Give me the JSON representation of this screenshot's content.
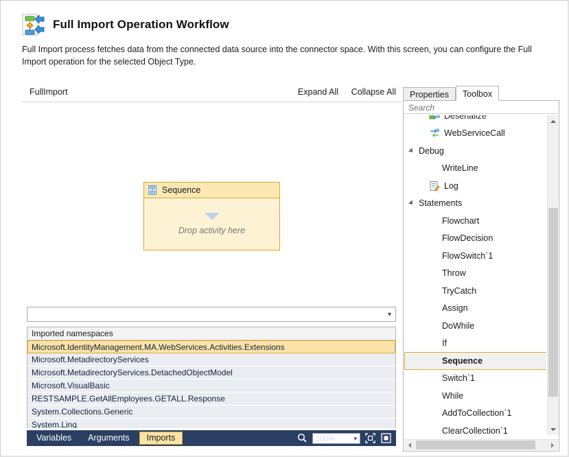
{
  "header": {
    "title": "Full Import Operation Workflow",
    "icon": "workflow-import-icon",
    "description": "Full Import process fetches data from the connected data source into the connector space. With this screen, you can configure the Full Import operation for the selected Object Type."
  },
  "designer": {
    "breadcrumb": "FullImport",
    "expand_all": "Expand All",
    "collapse_all": "Collapse All",
    "activity": {
      "icon": "sequence-activity-icon",
      "title": "Sequence",
      "drop_hint": "Drop activity here"
    },
    "namespace_combo": {
      "value": "",
      "placeholder": ""
    },
    "imports_grid": {
      "column_header": "Imported namespaces",
      "rows": [
        {
          "name": "Microsoft.IdentityManagement.MA.WebServices.Activities.Extensions",
          "selected": true
        },
        {
          "name": "Microsoft.MetadirectoryServices",
          "selected": false
        },
        {
          "name": "Microsoft.MetadirectoryServices.DetachedObjectModel",
          "selected": false
        },
        {
          "name": "Microsoft.VisualBasic",
          "selected": false
        },
        {
          "name": "RESTSAMPLE.GetAllEmployees.GETALL.Response",
          "selected": false
        },
        {
          "name": "System.Collections.Generic",
          "selected": false
        },
        {
          "name": "System.Linq",
          "selected": false
        }
      ]
    },
    "bottom_bar": {
      "tabs": [
        {
          "label": "Variables",
          "active": false
        },
        {
          "label": "Arguments",
          "active": false
        },
        {
          "label": "Imports",
          "active": true
        }
      ],
      "search_icon": "magnifier-icon",
      "zoom_value": "100%",
      "fit_to_screen_icon": "fit-to-screen-icon",
      "overview_map_icon": "overview-map-icon"
    }
  },
  "right_panel": {
    "tabs": [
      {
        "label": "Properties",
        "active": false
      },
      {
        "label": "Toolbox",
        "active": true
      }
    ],
    "search": {
      "placeholder": "Search",
      "value": ""
    },
    "tree": [
      {
        "label": "Deserialize",
        "type": "leaf",
        "icon": "deserialize-icon",
        "clipped": true,
        "selected": false
      },
      {
        "label": "WebServiceCall",
        "type": "leaf",
        "icon": "webservicecall-icon",
        "clipped": false,
        "selected": false
      },
      {
        "label": "Debug",
        "type": "group",
        "icon": "expander-icon",
        "clipped": false,
        "selected": false
      },
      {
        "label": "WriteLine",
        "type": "leaf",
        "icon": "",
        "clipped": false,
        "selected": false
      },
      {
        "label": "Log",
        "type": "leaf",
        "icon": "log-icon",
        "clipped": false,
        "selected": false
      },
      {
        "label": "Statements",
        "type": "group",
        "icon": "expander-icon",
        "clipped": false,
        "selected": false
      },
      {
        "label": "Flowchart",
        "type": "leaf",
        "icon": "",
        "clipped": false,
        "selected": false
      },
      {
        "label": "FlowDecision",
        "type": "leaf",
        "icon": "",
        "clipped": false,
        "selected": false
      },
      {
        "label": "FlowSwitch`1",
        "type": "leaf",
        "icon": "",
        "clipped": false,
        "selected": false
      },
      {
        "label": "Throw",
        "type": "leaf",
        "icon": "",
        "clipped": false,
        "selected": false
      },
      {
        "label": "TryCatch",
        "type": "leaf",
        "icon": "",
        "clipped": false,
        "selected": false
      },
      {
        "label": "Assign",
        "type": "leaf",
        "icon": "",
        "clipped": false,
        "selected": false
      },
      {
        "label": "DoWhile",
        "type": "leaf",
        "icon": "",
        "clipped": false,
        "selected": false
      },
      {
        "label": "If",
        "type": "leaf",
        "icon": "",
        "clipped": false,
        "selected": false
      },
      {
        "label": "Sequence",
        "type": "leaf",
        "icon": "",
        "clipped": false,
        "selected": true
      },
      {
        "label": "Switch`1",
        "type": "leaf",
        "icon": "",
        "clipped": false,
        "selected": false
      },
      {
        "label": "While",
        "type": "leaf",
        "icon": "",
        "clipped": false,
        "selected": false
      },
      {
        "label": "AddToCollection`1",
        "type": "leaf",
        "icon": "",
        "clipped": false,
        "selected": false
      },
      {
        "label": "ClearCollection`1",
        "type": "leaf",
        "icon": "",
        "clipped": false,
        "selected": false
      }
    ]
  },
  "colors": {
    "accent_yellow": "#fbe3a8",
    "accent_yellow_border": "#d9a930",
    "activity_fill": "#fdf3d4",
    "bottom_bar": "#2a3f63",
    "grid_row": "#eaedf2",
    "selection_gray": "#f1f1f1"
  }
}
